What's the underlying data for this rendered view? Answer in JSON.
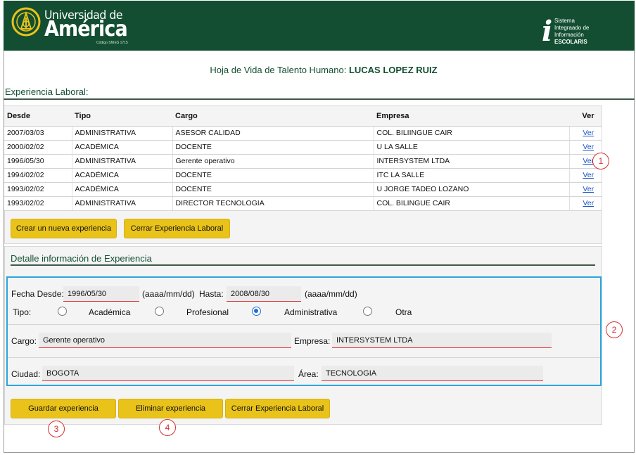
{
  "brand": {
    "line1": "Universidad de",
    "line2": "América",
    "code": "Código SNIES 1715"
  },
  "system": {
    "icon": "info-i-icon",
    "line1": "Sistema",
    "line2": "Integraado de",
    "line3": "Información",
    "line4": "ESCOLARIS"
  },
  "page": {
    "title_prefix": "Hoja de Vida de Talento Humano:",
    "person": "LUCAS LOPEZ RUIZ"
  },
  "section": {
    "title": "Experiencia Laboral:"
  },
  "table": {
    "headers": {
      "desde": "Desde",
      "tipo": "Tipo",
      "cargo": "Cargo",
      "empresa": "Empresa",
      "ver": "Ver"
    },
    "rows": [
      {
        "desde": "2007/03/03",
        "tipo": "ADMINISTRATIVA",
        "cargo": "ASESOR CALIDAD",
        "empresa": "COL. BILIINGUE CAIR",
        "ver": "Ver"
      },
      {
        "desde": "2000/02/02",
        "tipo": "ACADÉMICA",
        "cargo": "DOCENTE",
        "empresa": "U LA SALLE",
        "ver": "Ver"
      },
      {
        "desde": "1996/05/30",
        "tipo": "ADMINISTRATIVA",
        "cargo": "Gerente operativo",
        "empresa": "INTERSYSTEM LTDA",
        "ver": "Ver"
      },
      {
        "desde": "1994/02/02",
        "tipo": "ACADÉMICA",
        "cargo": "DOCENTE",
        "empresa": "ITC LA SALLE",
        "ver": "Ver"
      },
      {
        "desde": "1993/02/02",
        "tipo": "ACADÉMICA",
        "cargo": "DOCENTE",
        "empresa": "U JORGE TADEO LOZANO",
        "ver": "Ver"
      },
      {
        "desde": "1993/02/02",
        "tipo": "ADMINISTRATIVA",
        "cargo": "DIRECTOR TECNOLOGIA",
        "empresa": "COL. BILINGUE CAIR",
        "ver": "Ver"
      }
    ]
  },
  "buttons": {
    "new_experience": "Crear un nueva experiencia",
    "close_experience": "Cerrar Experiencia Laboral",
    "save": "Guardar experiencia",
    "delete": "Eliminar experiencia",
    "close_experience_2": "Cerrar Experiencia Laboral"
  },
  "detail": {
    "title": "Detalle información de Experiencia",
    "fecha_desde_label": "Fecha Desde:",
    "fecha_desde_value": "1996/05/30",
    "format_hint_1": "(aaaa/mm/dd)",
    "hasta_label": "Hasta:",
    "hasta_value": "2008/08/30",
    "format_hint_2": "(aaaa/mm/dd)",
    "tipo_label": "Tipo:",
    "tipo_options": [
      "Académica",
      "Profesional",
      "Administrativa",
      "Otra"
    ],
    "tipo_selected": "Administrativa",
    "cargo_label": "Cargo:",
    "cargo_value": "Gerente operativo",
    "empresa_label": "Empresa:",
    "empresa_value": "INTERSYSTEM LTDA",
    "ciudad_label": "Ciudad:",
    "ciudad_value": "BOGOTA",
    "area_label": "Área:",
    "area_value": "TECNOLOGIA"
  },
  "markers": [
    "1",
    "2",
    "3",
    "4"
  ],
  "colors": {
    "header_bg": "#134e32",
    "button_bg": "#e9c31a",
    "highlight_border": "#2aa6e1",
    "marker": "#d32f2f",
    "link": "#1a55c7"
  }
}
